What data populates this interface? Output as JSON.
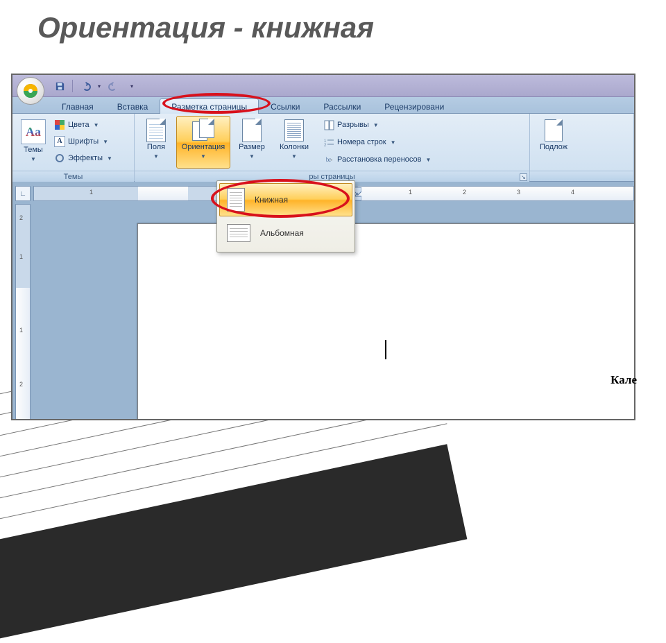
{
  "slide_title": "Ориентация - книжная",
  "qat": {
    "save": "save-icon",
    "undo": "undo-icon",
    "redo": "redo-icon"
  },
  "tabs": {
    "home": "Главная",
    "insert": "Вставка",
    "layout": "Разметка страницы",
    "refs": "Ссылки",
    "mail": "Рассылки",
    "review": "Рецензировани"
  },
  "themes": {
    "big": "Темы",
    "colors": "Цвета",
    "fonts": "Шрифты",
    "effects": "Эффекты",
    "group": "Темы"
  },
  "page_setup": {
    "margins": "Поля",
    "orientation": "Ориентация",
    "size": "Размер",
    "columns": "Колонки",
    "breaks": "Разрывы",
    "lines": "Номера строк",
    "hyphen": "Расстановка переносов",
    "group": "ры страницы"
  },
  "background": {
    "watermark": "Подлож"
  },
  "orientation_menu": {
    "portrait": "Книжная",
    "landscape": "Альбомная"
  },
  "ruler": {
    "h": [
      "1",
      "1",
      "2",
      "3",
      "4"
    ],
    "v": [
      "2",
      "1",
      "1",
      "2"
    ]
  },
  "doc_snippet": "Кале",
  "colors": {
    "accent": "#ffb328",
    "anno": "#d8111c"
  }
}
